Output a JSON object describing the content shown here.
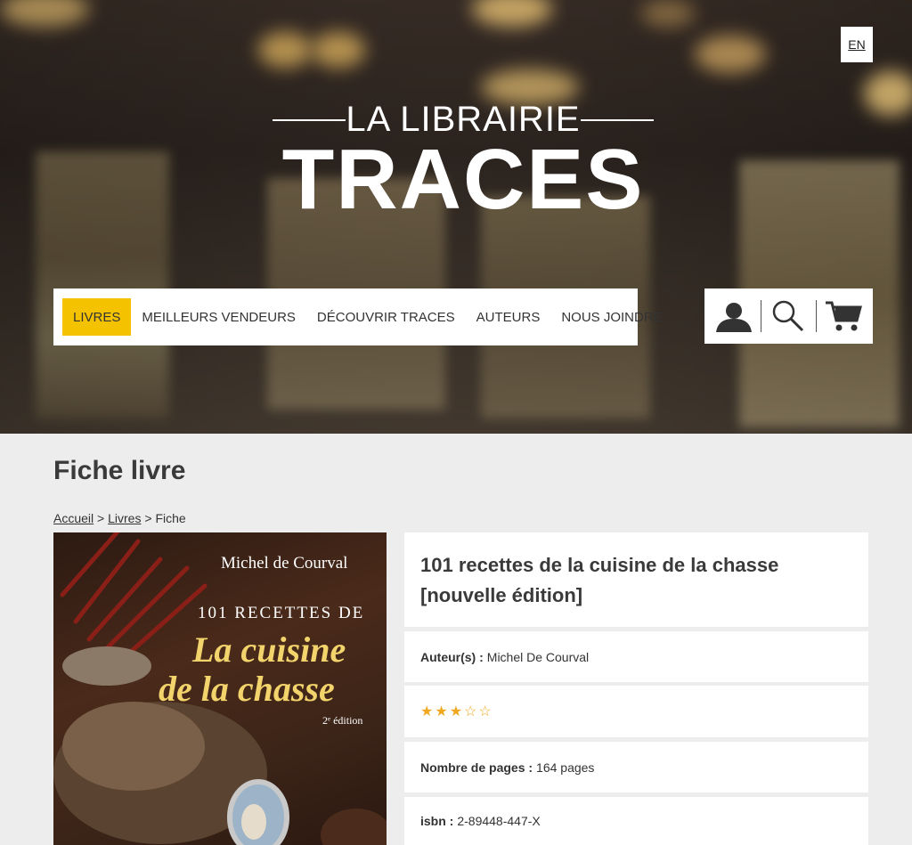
{
  "header": {
    "lang_button": "EN",
    "logo": {
      "top": "LA LIBRAIRIE",
      "main": "TRACES"
    },
    "nav": [
      {
        "label": "LIVRES",
        "active": true
      },
      {
        "label": "MEILLEURS VENDEURS"
      },
      {
        "label": "DÉCOUVRIR TRACES"
      },
      {
        "label": "AUTEURS"
      },
      {
        "label": "NOUS JOINDRE"
      }
    ],
    "tools": [
      "user-icon",
      "search-icon",
      "cart-icon"
    ],
    "accent_color": "#f5c200"
  },
  "page": {
    "title": "Fiche livre",
    "breadcrumb": {
      "home": "Accueil",
      "sep": ">",
      "books": "Livres",
      "current": "Fiche"
    }
  },
  "book": {
    "cover": {
      "author": "Michel de Courval",
      "line1": "101 RECETTES DE",
      "line2": "La cuisine",
      "line3": "de la chasse",
      "edition": "2ᵉ édition"
    },
    "title": "101 recettes de la cuisine de la chasse [nouvelle édition]",
    "author_label": "Auteur(s) :",
    "author": "Michel De Courval",
    "rating": 3,
    "rating_max": 5,
    "rating_display": "★★★☆☆",
    "star_color": "#f0a81e",
    "pages_label": "Nombre de pages :",
    "pages": "164 pages",
    "isbn_label": "isbn :",
    "isbn": "2-89448-447-X"
  }
}
